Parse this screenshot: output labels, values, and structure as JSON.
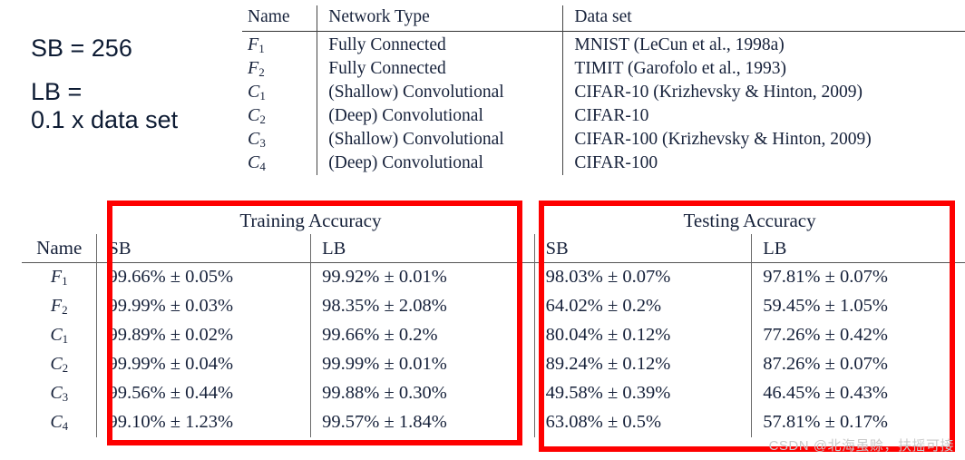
{
  "annotations": {
    "line1": "SB = 256",
    "line2": "LB =",
    "line3": "0.1 x data set"
  },
  "network_table": {
    "headers": {
      "name": "Name",
      "network_type": "Network Type",
      "data_set": "Data set"
    },
    "rows": [
      {
        "name": "F",
        "sub": "1",
        "network_type": "Fully Connected",
        "data_set": "MNIST (LeCun et al., 1998a)"
      },
      {
        "name": "F",
        "sub": "2",
        "network_type": "Fully Connected",
        "data_set": "TIMIT (Garofolo et al., 1993)"
      },
      {
        "name": "C",
        "sub": "1",
        "network_type": "(Shallow) Convolutional",
        "data_set": "CIFAR-10 (Krizhevsky & Hinton, 2009)"
      },
      {
        "name": "C",
        "sub": "2",
        "network_type": "(Deep) Convolutional",
        "data_set": "CIFAR-10"
      },
      {
        "name": "C",
        "sub": "3",
        "network_type": "(Shallow) Convolutional",
        "data_set": "CIFAR-100 (Krizhevsky & Hinton, 2009)"
      },
      {
        "name": "C",
        "sub": "4",
        "network_type": "(Deep) Convolutional",
        "data_set": "CIFAR-100"
      }
    ]
  },
  "accuracy_table": {
    "headers": {
      "name": "Name",
      "training_accuracy": "Training Accuracy",
      "testing_accuracy": "Testing Accuracy",
      "sb": "SB",
      "lb": "LB"
    },
    "rows": [
      {
        "name": "F",
        "sub": "1",
        "train_sb": "99.66% ± 0.05%",
        "train_lb": "99.92% ± 0.01%",
        "test_sb": "98.03% ± 0.07%",
        "test_lb": "97.81% ± 0.07%"
      },
      {
        "name": "F",
        "sub": "2",
        "train_sb": "99.99% ± 0.03%",
        "train_lb": "98.35% ± 2.08%",
        "test_sb": "64.02% ± 0.2%",
        "test_lb": "59.45% ± 1.05%"
      },
      {
        "name": "C",
        "sub": "1",
        "train_sb": "99.89% ± 0.02%",
        "train_lb": "99.66% ± 0.2%",
        "test_sb": "80.04% ± 0.12%",
        "test_lb": "77.26% ± 0.42%"
      },
      {
        "name": "C",
        "sub": "2",
        "train_sb": "99.99% ± 0.04%",
        "train_lb": "99.99% ± 0.01%",
        "test_sb": "89.24% ± 0.12%",
        "test_lb": "87.26% ± 0.07%"
      },
      {
        "name": "C",
        "sub": "3",
        "train_sb": "99.56% ± 0.44%",
        "train_lb": "99.88% ± 0.30%",
        "test_sb": "49.58% ± 0.39%",
        "test_lb": "46.45% ± 0.43%"
      },
      {
        "name": "C",
        "sub": "4",
        "train_sb": "99.10% ± 1.23%",
        "train_lb": "99.57% ± 1.84%",
        "test_sb": "63.08% ± 0.5%",
        "test_lb": "57.81% ± 0.17%"
      }
    ]
  },
  "highlight_color": "#fe0000",
  "watermark": "CSDN @北海虽赊，扶摇可接"
}
